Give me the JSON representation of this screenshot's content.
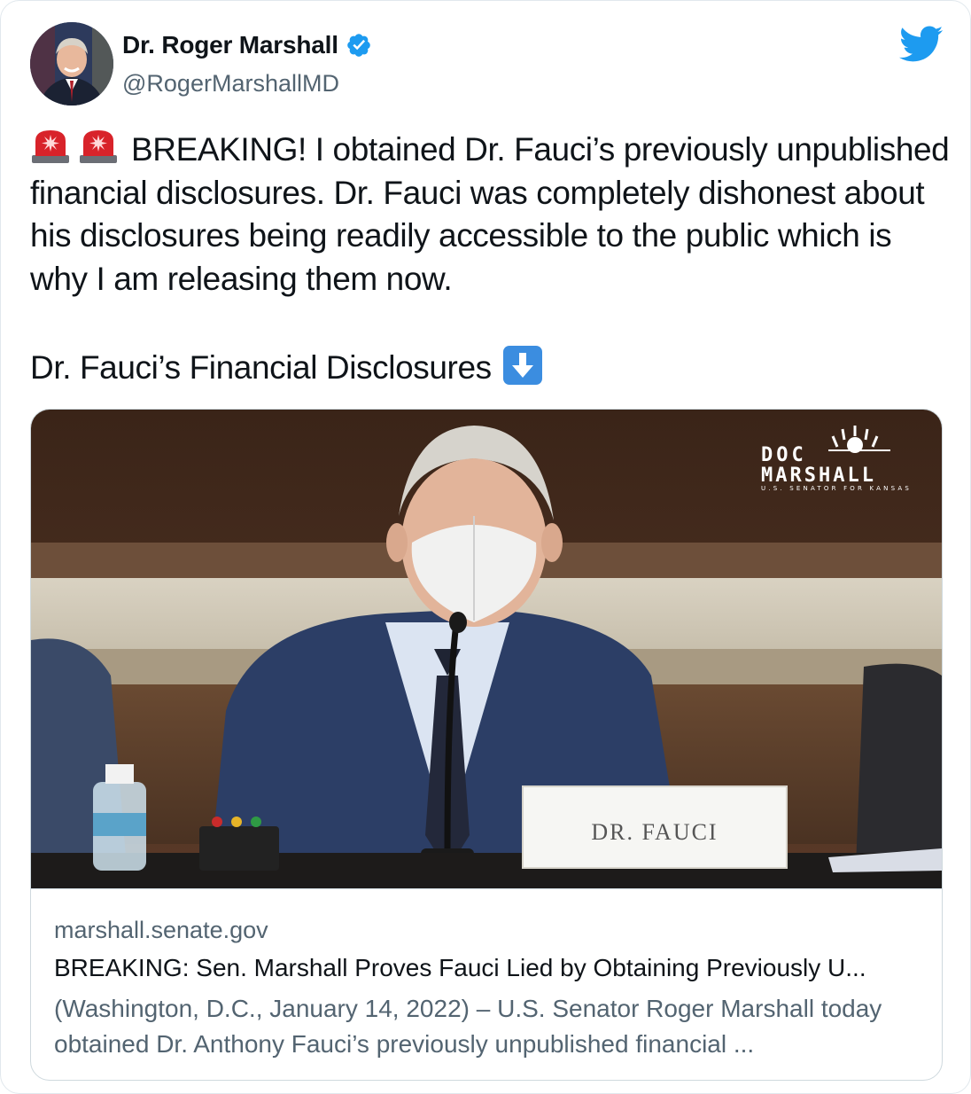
{
  "author": {
    "display_name": "Dr. Roger Marshall",
    "handle": "@RogerMarshallMD",
    "verified": true
  },
  "icons": [
    "verified-badge-icon",
    "twitter-bird-icon",
    "rotating-light-icon",
    "down-arrow-icon"
  ],
  "colors": {
    "twitter_blue": "#1d9bf0",
    "text_primary": "#0f1419",
    "text_secondary": "#536471"
  },
  "tweet": {
    "body": "BREAKING! I obtained Dr. Fauci’s previously unpublished financial disclosures. Dr. Fauci was completely dishonest about his disclosures being readily accessible to the public which is why I am releasing them now.",
    "line2": "Dr. Fauci’s Financial Disclosures"
  },
  "card": {
    "image_logo_line1": "DOC",
    "image_logo_line2": "MARSHALL",
    "image_logo_tagline": "U.S. SENATOR FOR KANSAS",
    "image_nameplate": "DR. FAUCI",
    "domain": "marshall.senate.gov",
    "title": "BREAKING: Sen. Marshall Proves Fauci Lied by Obtaining Previously U...",
    "description": "(Washington, D.C., January 14, 2022) – U.S. Senator Roger Marshall today obtained Dr. Anthony Fauci’s previously unpublished financial ..."
  }
}
